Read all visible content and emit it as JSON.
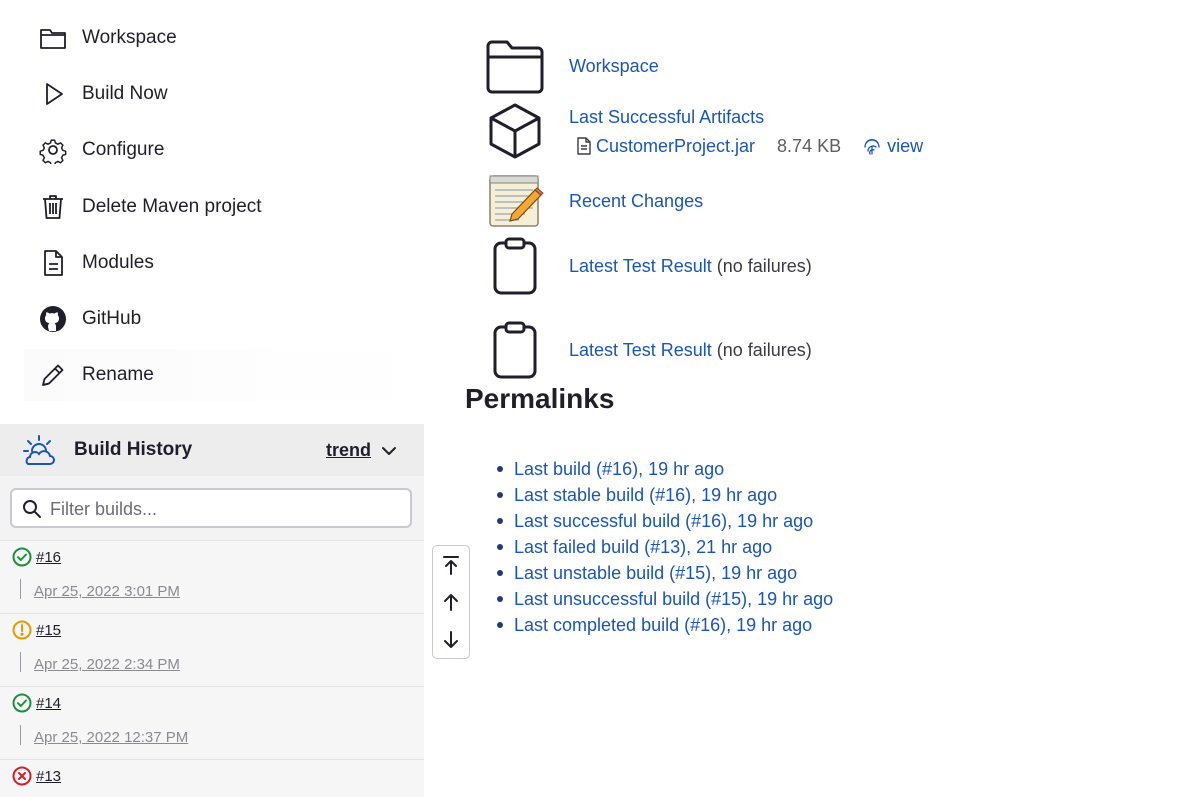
{
  "sidebar": {
    "tasks": [
      {
        "label": "Workspace",
        "icon": "folder-icon"
      },
      {
        "label": "Build Now",
        "icon": "play-icon"
      },
      {
        "label": "Configure",
        "icon": "gear-icon"
      },
      {
        "label": "Delete Maven project",
        "icon": "trash-icon"
      },
      {
        "label": "Modules",
        "icon": "document-icon"
      },
      {
        "label": "GitHub",
        "icon": "github-icon"
      },
      {
        "label": "Rename",
        "icon": "pencil-icon"
      }
    ]
  },
  "build_history": {
    "title": "Build History",
    "trend_label": "trend",
    "filter_placeholder": "Filter builds...",
    "builds": [
      {
        "number": "#16",
        "date": "Apr 25, 2022 3:01 PM",
        "status": "success"
      },
      {
        "number": "#15",
        "date": "Apr 25, 2022 2:34 PM",
        "status": "unstable"
      },
      {
        "number": "#14",
        "date": "Apr 25, 2022 12:37 PM",
        "status": "success"
      },
      {
        "number": "#13",
        "date": "",
        "status": "failed"
      }
    ]
  },
  "main": {
    "workspace_link": "Workspace",
    "artifacts_link": "Last Successful Artifacts",
    "artifact": {
      "name": "CustomerProject.jar",
      "size": "8.74 KB",
      "view_label": "view"
    },
    "recent_changes_link": "Recent Changes",
    "test_results": [
      {
        "link": "Latest Test Result",
        "note": "(no failures)"
      },
      {
        "link": "Latest Test Result",
        "note": "(no failures)"
      }
    ],
    "permalinks_title": "Permalinks",
    "permalinks": [
      "Last build (#16), 19 hr ago",
      "Last stable build (#16), 19 hr ago",
      "Last successful build (#16), 19 hr ago",
      "Last failed build (#13), 21 hr ago",
      "Last unstable build (#15), 19 hr ago",
      "Last unsuccessful build (#15), 19 hr ago",
      "Last completed build (#16), 19 hr ago"
    ]
  },
  "colors": {
    "link": "#1a56b8",
    "success": "#1e8f3e",
    "unstable": "#e59a00",
    "failed": "#d31f2a"
  }
}
